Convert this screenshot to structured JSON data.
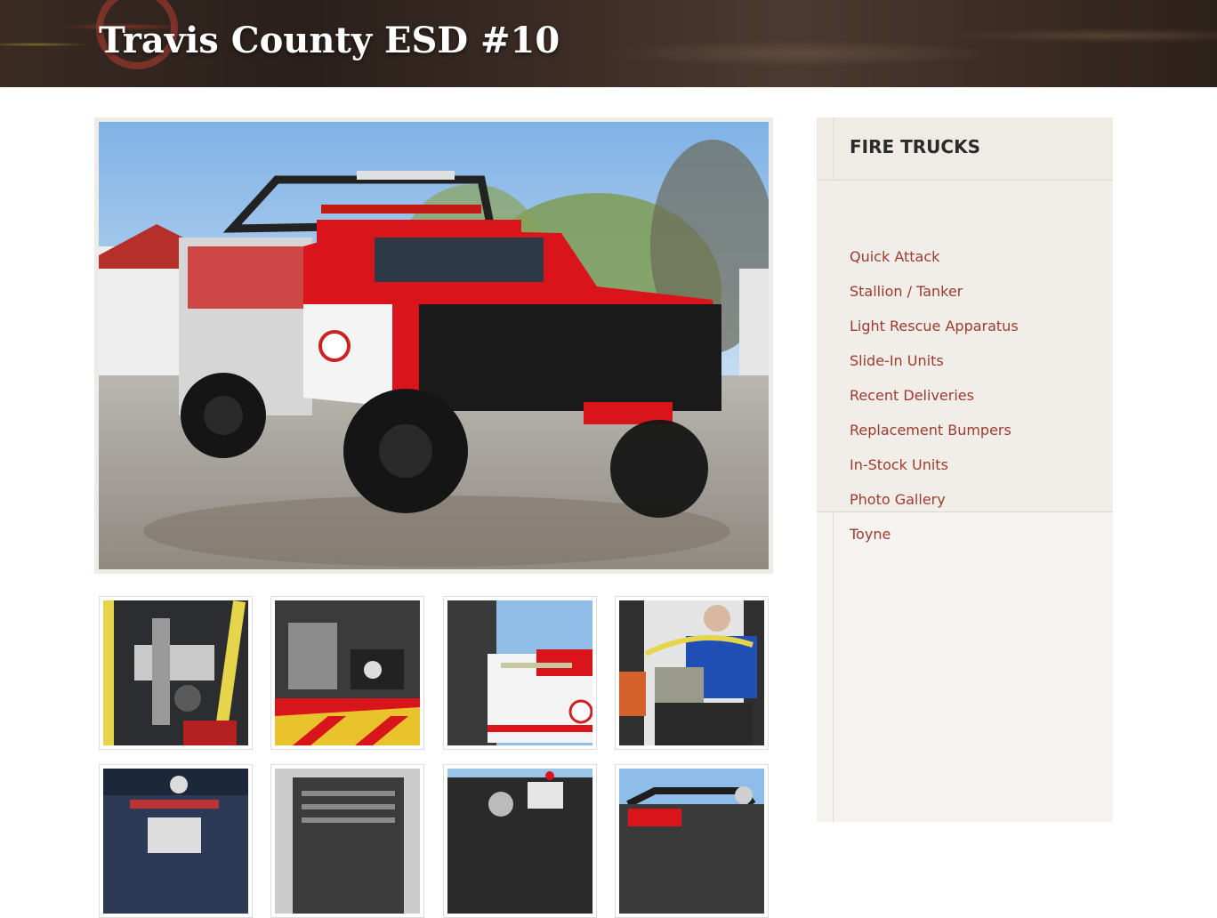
{
  "site": {
    "title": "Travis County ESD #10"
  },
  "gallery": {
    "main_photo": "fire-truck-photo",
    "thumbnails": [
      "pump-panel-photo",
      "pump-compartment-photo",
      "side-compartment-photo",
      "operator-with-hose-photo",
      "control-panel-photo",
      "rear-compartment-photo",
      "rear-deck-photo",
      "roll-cage-photo"
    ]
  },
  "sidebar": {
    "title": "FIRE TRUCKS",
    "items": [
      {
        "label": "Quick Attack"
      },
      {
        "label": "Stallion / Tanker"
      },
      {
        "label": "Light Rescue Apparatus"
      },
      {
        "label": "Slide-In Units"
      },
      {
        "label": "Recent Deliveries"
      },
      {
        "label": "Replacement Bumpers"
      },
      {
        "label": "In-Stock Units"
      },
      {
        "label": "Photo Gallery"
      },
      {
        "label": "Toyne"
      }
    ]
  },
  "colors": {
    "link": "#9c3b2e",
    "sidebar_bg": "#f5f3ef",
    "truck_red": "#d9141b"
  }
}
